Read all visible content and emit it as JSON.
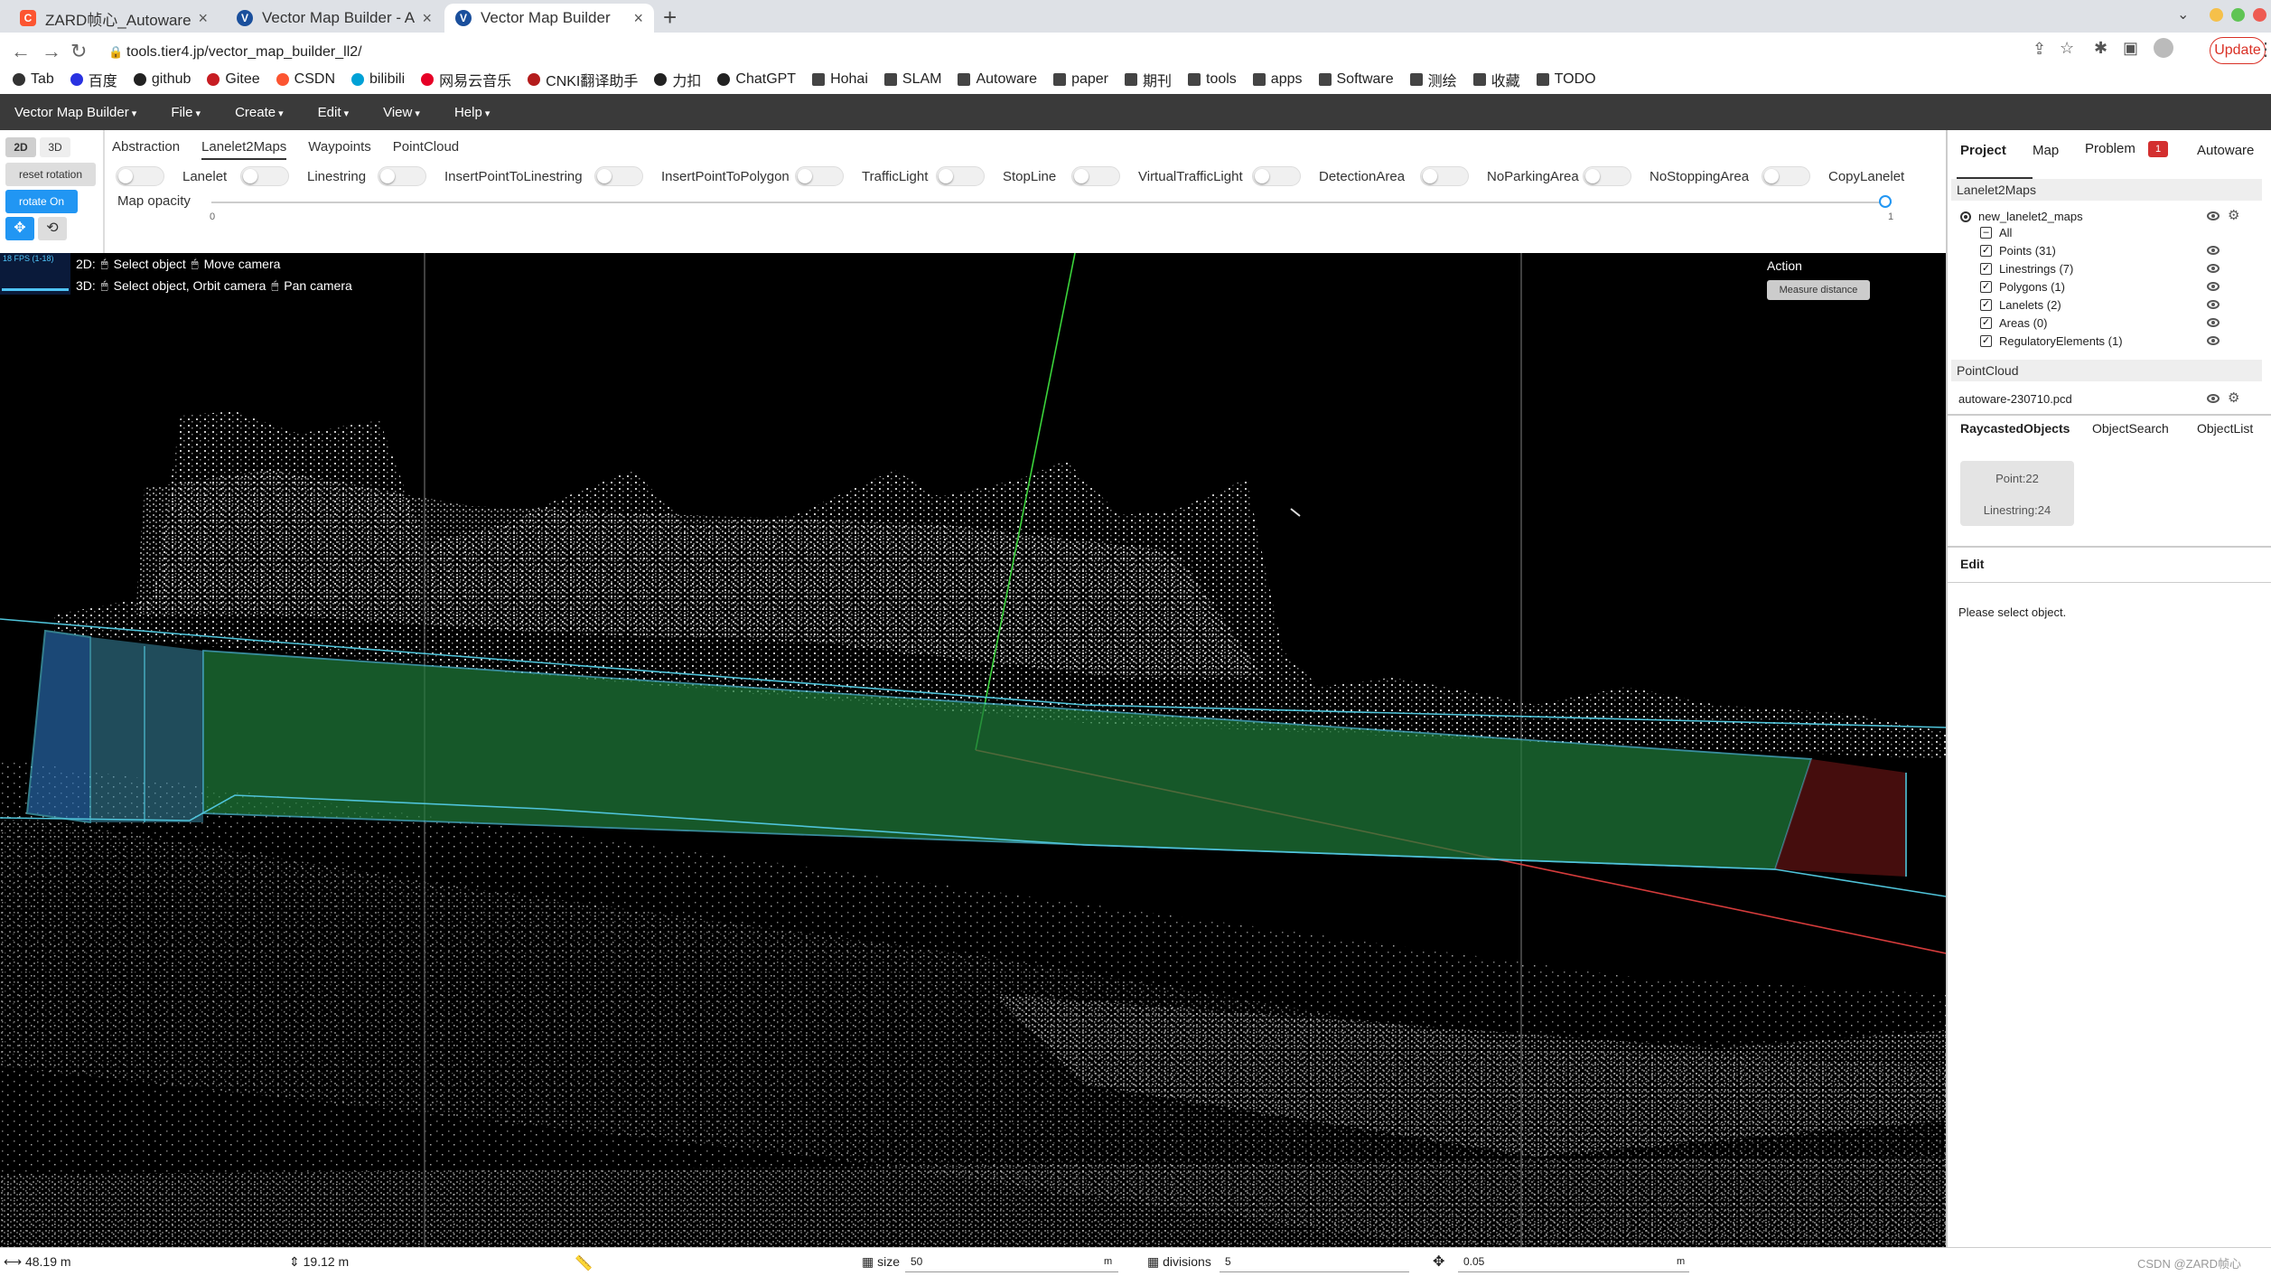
{
  "browser": {
    "tabs": [
      {
        "title": "ZARD帧心_Autoware.ai激光雷达",
        "favicon": "C"
      },
      {
        "title": "Vector Map Builder - Autoware",
        "favicon": "V"
      },
      {
        "title": "Vector Map Builder",
        "favicon": "V"
      }
    ],
    "url": "tools.tier4.jp/vector_map_builder_ll2/",
    "update_label": "Update",
    "bookmarks": [
      "Tab",
      "百度",
      "github",
      "Gitee",
      "CSDN",
      "bilibili",
      "网易云音乐",
      "CNKI翻译助手",
      "力扣",
      "ChatGPT",
      "Hohai",
      "SLAM",
      "Autoware",
      "paper",
      "期刊",
      "tools",
      "apps",
      "Software",
      "测绘",
      "收藏",
      "TODO"
    ]
  },
  "menubar": {
    "items": [
      "Vector Map Builder",
      "File",
      "Create",
      "Edit",
      "View",
      "Help"
    ]
  },
  "view_controls": {
    "mode_2d": "2D",
    "mode_3d": "3D",
    "reset_rotation": "reset rotation",
    "rotate_on": "rotate On"
  },
  "subtabs": [
    "Abstraction",
    "Lanelet2Maps",
    "Waypoints",
    "PointCloud"
  ],
  "toggles": [
    "Lanelet",
    "Linestring",
    "InsertPointToLinestring",
    "InsertPointToPolygon",
    "TrafficLight",
    "StopLine",
    "VirtualTrafficLight",
    "DetectionArea",
    "NoParkingArea",
    "NoStoppingArea",
    "CopyLanelet"
  ],
  "map_opacity": {
    "label": "Map opacity",
    "min": "0",
    "max": "1",
    "value": 1
  },
  "viewport": {
    "fps": "18 FPS (1-18)",
    "hint_2d_prefix": "2D:",
    "hint_2d_left": "Select object",
    "hint_2d_right": "Move camera",
    "hint_3d_prefix": "3D:",
    "hint_3d_left": "Select object, Orbit camera",
    "hint_3d_right": "Pan camera",
    "action_label": "Action",
    "measure_button": "Measure distance"
  },
  "right_panel": {
    "tabs": [
      "Project",
      "Map",
      "Problem",
      "Autoware"
    ],
    "problem_count": "1",
    "lanelet_section": "Lanelet2Maps",
    "map_name": "new_lanelet2_maps",
    "layers": [
      "All",
      "Points (31)",
      "Linestrings (7)",
      "Polygons (1)",
      "Lanelets (2)",
      "Areas (0)",
      "RegulatoryElements (1)"
    ],
    "pointcloud_section": "PointCloud",
    "pcd_file": "autoware-230710.pcd",
    "object_tabs": [
      "RaycastedObjects",
      "ObjectSearch",
      "ObjectList"
    ],
    "raycast_point": "Point:22",
    "raycast_linestring": "Linestring:24",
    "edit_label": "Edit",
    "edit_message": "Please select object."
  },
  "statusbar": {
    "width": "48.19 m",
    "height": "19.12 m",
    "size_label": "size",
    "size_value": "50",
    "size_unit": "m",
    "divisions_label": "divisions",
    "divisions_value": "5",
    "snap_value": "0.05",
    "snap_unit": "m",
    "watermark": "CSDN @ZARD帧心"
  },
  "colors": {
    "menubar": "#3a3a3a",
    "accent": "#2196f3",
    "problem_badge": "#d32f2f",
    "lane_fill": "#1f7a3a",
    "lane_border": "#4fc3d9"
  }
}
